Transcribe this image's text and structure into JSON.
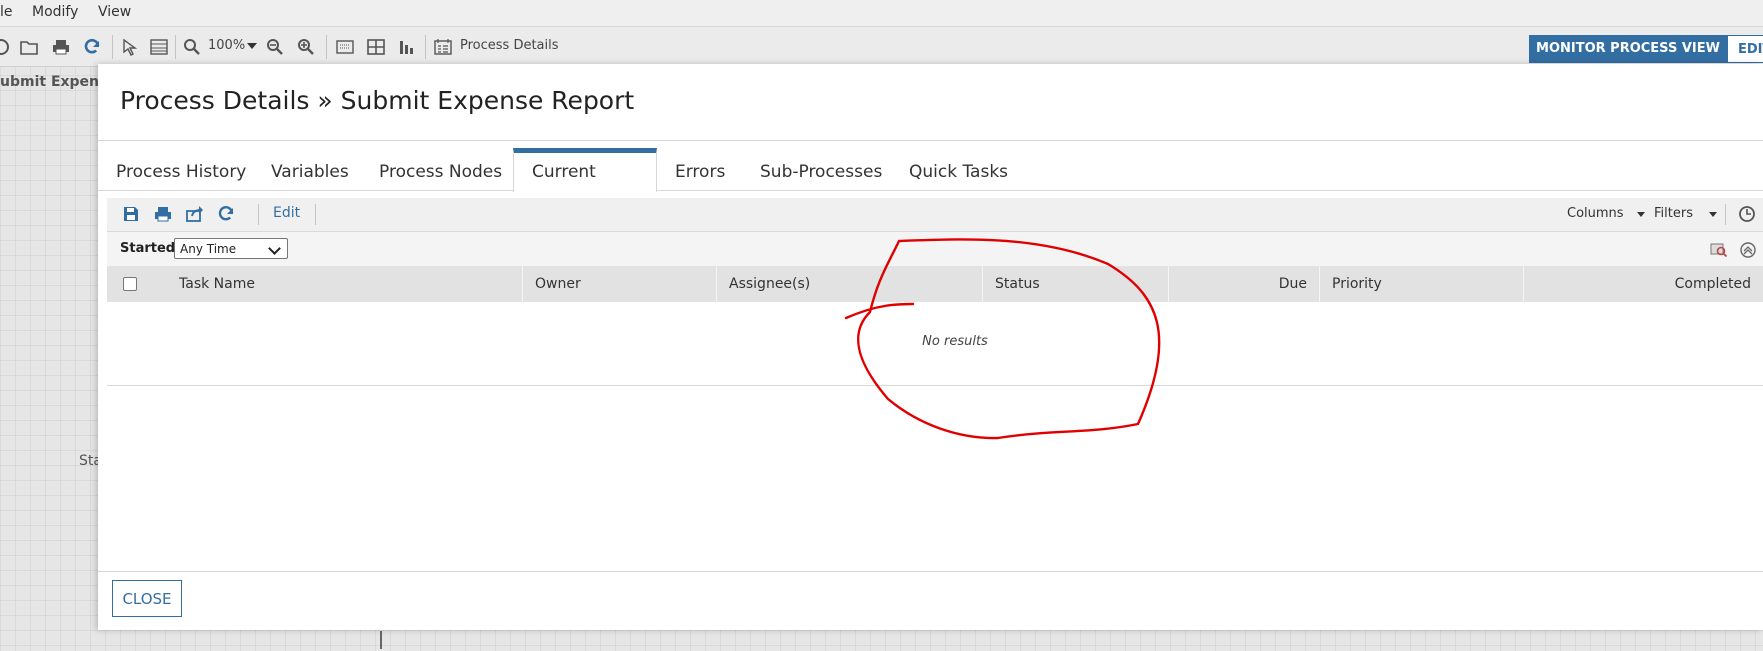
{
  "menu": {
    "items": [
      "le",
      "Modify",
      "View"
    ]
  },
  "toolbar": {
    "zoom": "100%",
    "process_details_label": "Process Details"
  },
  "view_buttons": {
    "monitor": "MONITOR PROCESS VIEW",
    "edit": "EDIT"
  },
  "background": {
    "title": "ubmit Expense",
    "start_label": "Sta"
  },
  "modal": {
    "title": "Process Details » Submit Expense Report",
    "tabs": [
      "Process History",
      "Variables",
      "Process Nodes",
      "Current Tasks",
      "Errors",
      "Sub-Processes",
      "Quick Tasks"
    ],
    "active_tab": "Current Tasks",
    "grid_toolbar": {
      "edit": "Edit",
      "columns": "Columns",
      "filters": "Filters"
    },
    "filter": {
      "label": "Started",
      "selected": "Any Time"
    },
    "columns": [
      "Task Name",
      "Owner",
      "Assignee(s)",
      "Status",
      "Due",
      "Priority",
      "Completed"
    ],
    "empty_message": "No results",
    "close_label": "CLOSE"
  },
  "colors": {
    "accent": "#336ea3",
    "annotation": "#e00000"
  }
}
